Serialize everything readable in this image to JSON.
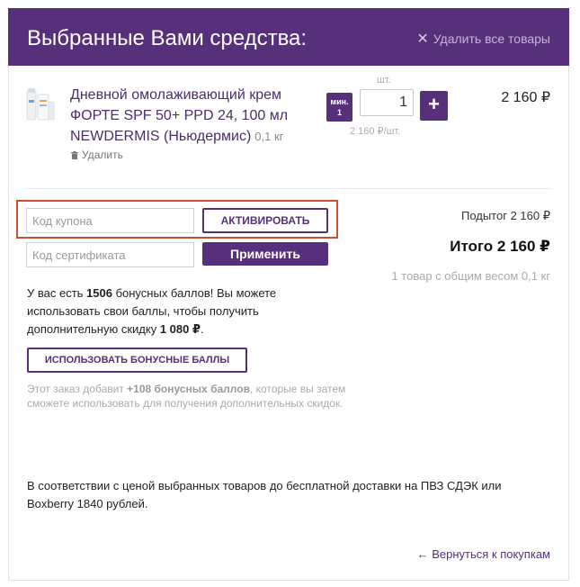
{
  "header": {
    "title": "Выбранные Вами средства:",
    "clear_all_label": "Удалить все товары"
  },
  "item": {
    "name": "Дневной омолаживающий крем ФОРТЕ SPF 50+ PPD 24, 100 мл NEWDERMIS (Ньюдермис)",
    "weight": "0,1 кг",
    "remove_label": "Удалить",
    "qty_unit": "шт.",
    "min_label_1": "мин.",
    "min_label_2": "1",
    "quantity": "1",
    "plus_label": "+",
    "unit_price": "2 160 ₽/шт.",
    "line_total": "2 160 ₽"
  },
  "coupon": {
    "placeholder": "Код купона",
    "activate_label": "АКТИВИРОВАТЬ"
  },
  "certificate": {
    "placeholder": "Код сертификата",
    "apply_label": "Применить"
  },
  "totals": {
    "subtotal": "Подытог 2 160 ₽",
    "total": "Итого 2 160 ₽",
    "summary": "1 товар с общим весом 0,1 кг"
  },
  "bonus": {
    "text_1": "У вас есть ",
    "points": "1506",
    "text_2": " бонусных баллов! Вы можете использовать свои баллы, чтобы получить дополнительную скидку ",
    "discount": "1 080 ₽",
    "text_3": ".",
    "use_button_label": "ИСПОЛЬЗОВАТЬ БОНУСНЫЕ БАЛЛЫ",
    "note_1": "Этот заказ добавит ",
    "note_points": "+108 бонусных баллов",
    "note_2": ", которые вы затем сможете использовать для получения дополнительных скидок."
  },
  "delivery_note": "В соответствии с ценой выбранных товаров до бесплатной доставки на ПВЗ СДЭК или Boxberry 1840 рублей.",
  "back_link_label": "← Вернуться к покупкам",
  "colors": {
    "brand": "#56307a",
    "highlight": "#c8512b"
  },
  "icons": {
    "clear_all": "close-icon",
    "remove": "trash-icon"
  }
}
